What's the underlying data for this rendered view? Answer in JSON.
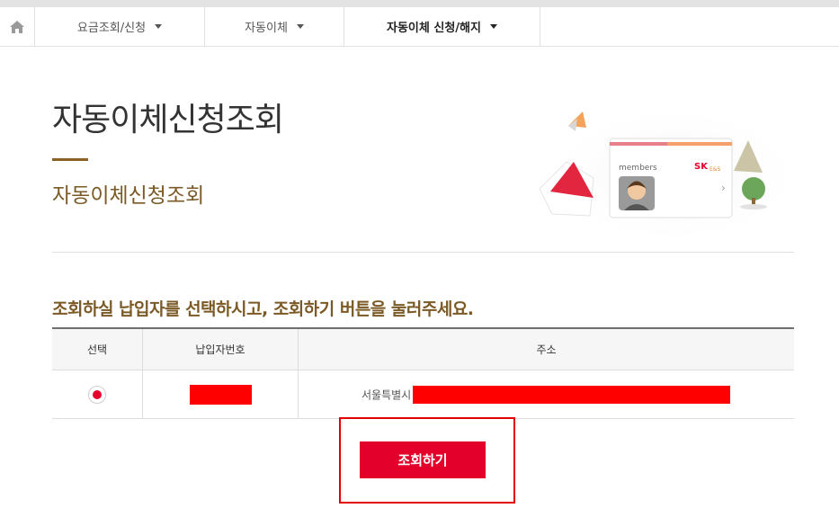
{
  "nav": {
    "items": [
      {
        "label": "요금조회/신청",
        "active": false
      },
      {
        "label": "자동이체",
        "active": false
      },
      {
        "label": "자동이체 신청/해지",
        "active": true
      }
    ]
  },
  "page": {
    "title": "자동이체신청조회",
    "subtitle": "자동이체신청조회"
  },
  "illustration": {
    "card_label": "members",
    "card_brand": "SK",
    "card_brand_sub": "E&S"
  },
  "instruction": "조회하실 납입자를 선택하시고, 조회하기 버튼을 눌러주세요.",
  "table": {
    "headers": [
      "선택",
      "납입자번호",
      "주소"
    ],
    "rows": [
      {
        "selected": true,
        "payer_number": "",
        "address_prefix": "서울특별시",
        "address_rest": ""
      }
    ]
  },
  "buttons": {
    "search_label": "조회하기"
  },
  "colors": {
    "accent": "#e3002b",
    "brand_brown": "#7b5a26",
    "redaction": "#ff0000"
  }
}
